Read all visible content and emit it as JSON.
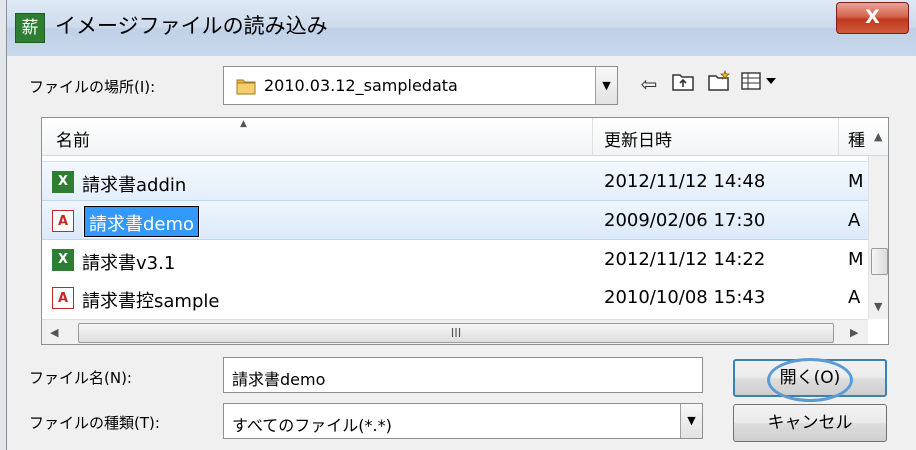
{
  "window": {
    "title": "イメージファイルの読み込み",
    "close_label": "X",
    "app_icon_glyph": "薪"
  },
  "location": {
    "label": "ファイルの場所(I):",
    "value": "2010.03.12_sampledata"
  },
  "toolbar": {
    "back_icon": "⇦",
    "up_icon": "⬆",
    "newfolder_icon": "✱",
    "view_icon": "▤▾"
  },
  "columns": {
    "name": "名前",
    "modified": "更新日時",
    "type": "種"
  },
  "files": [
    {
      "name": "請求書addin",
      "date": "2012/11/12 14:48",
      "type": "M",
      "icon": "excel-file",
      "glyph": "X"
    },
    {
      "name": "請求書demo",
      "date": "2009/02/06 17:30",
      "type": "A",
      "icon": "pdf-file",
      "glyph": "A"
    },
    {
      "name": "請求書v3.1",
      "date": "2012/11/12 14:22",
      "type": "M",
      "icon": "excel-file",
      "glyph": "X"
    },
    {
      "name": "請求書控sample",
      "date": "2010/10/08 15:43",
      "type": "A",
      "icon": "pdf-file",
      "glyph": "A"
    }
  ],
  "selected_index": 1,
  "filename": {
    "label": "ファイル名(N):",
    "value": "請求書demo"
  },
  "filetype": {
    "label": "ファイルの種類(T):",
    "value": "すべてのファイル(*.*)"
  },
  "buttons": {
    "open": "開く(O)",
    "cancel": "キャンセル"
  },
  "scroll": {
    "hgrip": "III"
  },
  "colors": {
    "accent": "#3399ff",
    "selection": "#dbe9fa",
    "default_button_border": "#3c7fb1"
  }
}
